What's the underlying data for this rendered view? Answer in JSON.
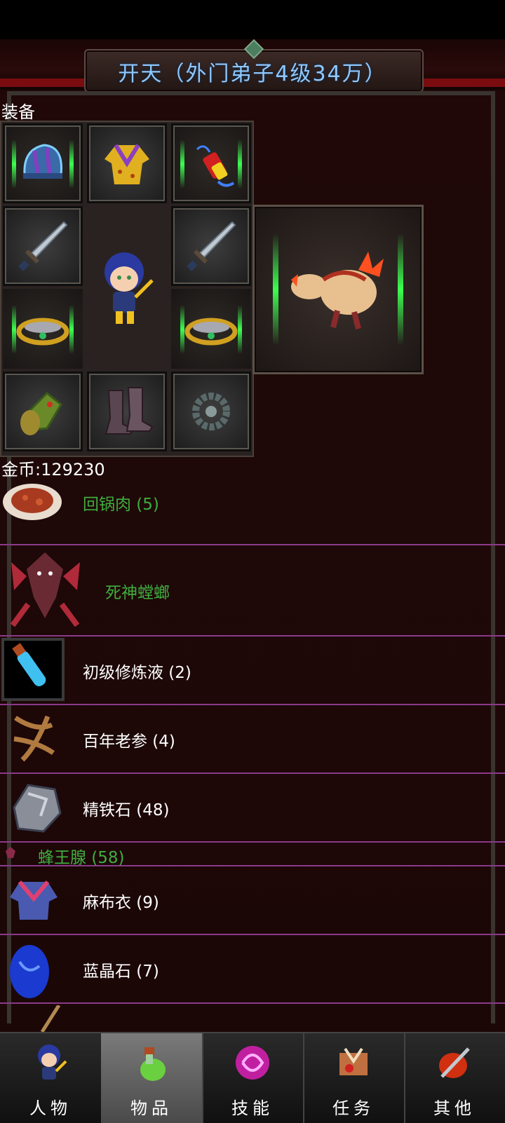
{
  "header": {
    "title": "开天（外门弟子4级34万）"
  },
  "equipment": {
    "label": "装备",
    "slots": [
      {
        "id": "helmet",
        "icon": "helmet-icon"
      },
      {
        "id": "armor",
        "icon": "robe-icon"
      },
      {
        "id": "accessory",
        "icon": "firecracker-icon"
      },
      {
        "id": "weapon-left",
        "icon": "sword-icon"
      },
      {
        "id": "weapon-right",
        "icon": "sword-icon"
      },
      {
        "id": "ring-left",
        "icon": "ring-icon"
      },
      {
        "id": "ring-right",
        "icon": "ring-icon"
      },
      {
        "id": "bracer",
        "icon": "bracer-icon"
      },
      {
        "id": "boots",
        "icon": "boots-icon"
      },
      {
        "id": "necklace",
        "icon": "prayer-beads-icon"
      }
    ],
    "pet_icon": "fire-lizard-icon",
    "avatar_icon": "hero-avatar-icon"
  },
  "gold": {
    "text": "金币:129230"
  },
  "items": [
    {
      "name": "回锅肉 (5)",
      "color": "#3fae3f",
      "icon": "twice-cooked-pork-icon"
    },
    {
      "name": "死神螳螂",
      "color": "#3fae3f",
      "icon": "death-mantis-icon"
    },
    {
      "name": "初级修炼液 (2)",
      "color": "#ffffff",
      "icon": "potion-vial-icon"
    },
    {
      "name": "百年老参 (4)",
      "color": "#ffffff",
      "icon": "ginseng-icon"
    },
    {
      "name": "精铁石 (48)",
      "color": "#ffffff",
      "icon": "iron-ore-icon"
    },
    {
      "name": "蜂王腺 (58)",
      "color": "#3fae3f",
      "icon": "bee-gland-icon"
    },
    {
      "name": "麻布衣 (9)",
      "color": "#ffffff",
      "icon": "linen-robe-icon"
    },
    {
      "name": "蓝晶石 (7)",
      "color": "#ffffff",
      "icon": "blue-crystal-icon"
    }
  ],
  "tabs": [
    {
      "label": "人物",
      "icon": "character-icon",
      "active": false
    },
    {
      "label": "物品",
      "icon": "items-potion-icon",
      "active": true
    },
    {
      "label": "技能",
      "icon": "skill-orb-icon",
      "active": false
    },
    {
      "label": "任务",
      "icon": "quest-icon",
      "active": false
    },
    {
      "label": "其他",
      "icon": "other-icon",
      "active": false
    }
  ],
  "colors": {
    "background": "#1a0606",
    "title": "#8fc8ff",
    "green_item": "#3fae3f",
    "divider": "#8a3a8a"
  }
}
